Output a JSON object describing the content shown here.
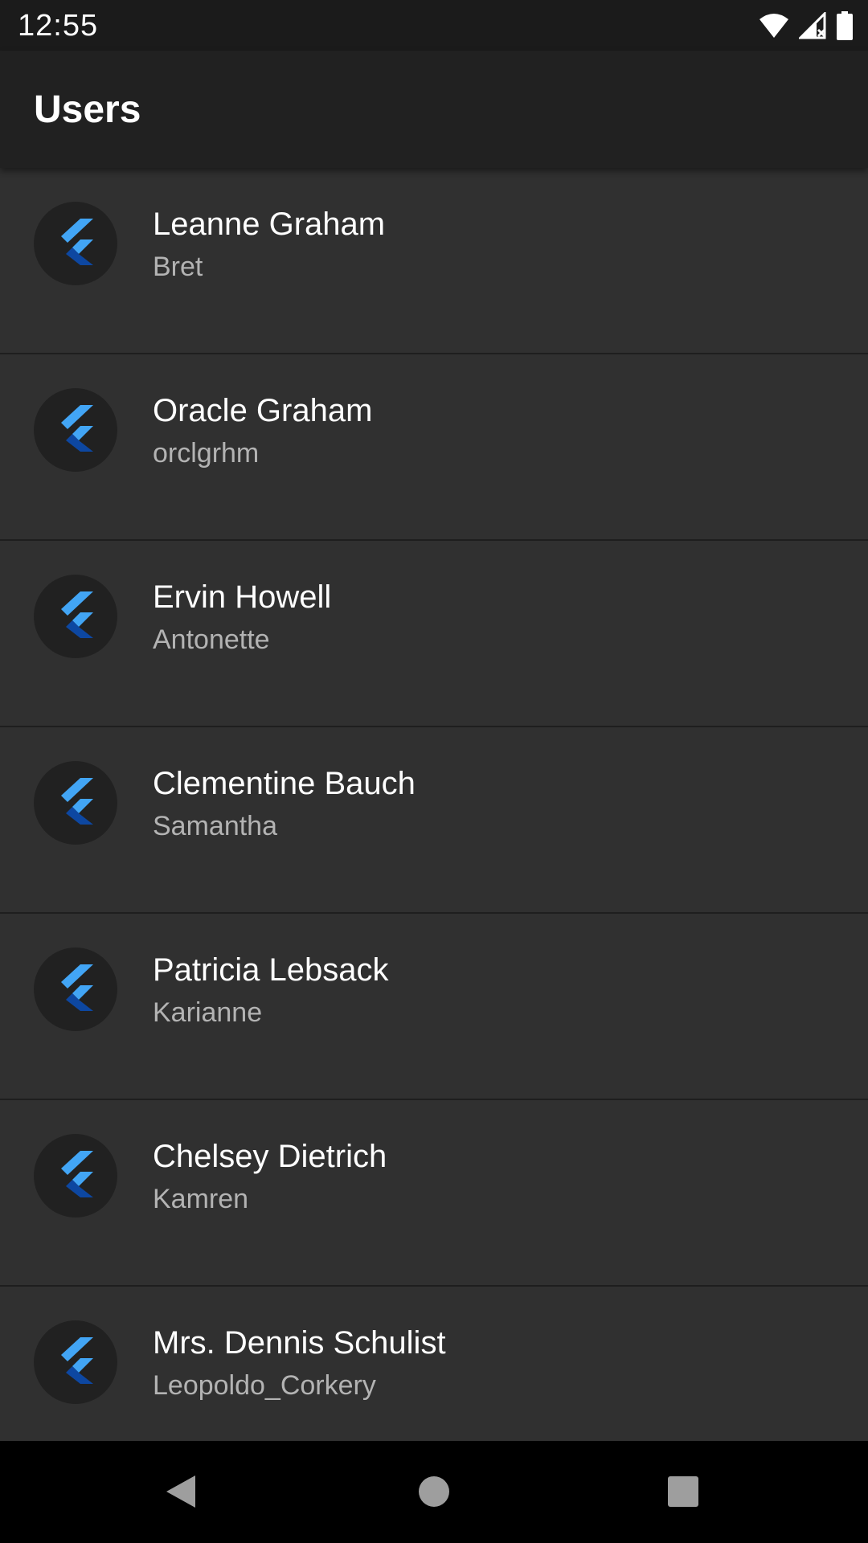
{
  "status_bar": {
    "time": "12:55",
    "icons": [
      "wifi-icon",
      "signal-icon",
      "battery-icon"
    ]
  },
  "app_bar": {
    "title": "Users"
  },
  "users": [
    {
      "name": "Leanne Graham",
      "username": "Bret"
    },
    {
      "name": "Oracle Graham",
      "username": "orclgrhm"
    },
    {
      "name": "Ervin Howell",
      "username": "Antonette"
    },
    {
      "name": "Clementine Bauch",
      "username": "Samantha"
    },
    {
      "name": "Patricia Lebsack",
      "username": "Karianne"
    },
    {
      "name": "Chelsey Dietrich",
      "username": "Kamren"
    },
    {
      "name": "Mrs. Dennis Schulist",
      "username": "Leopoldo_Corkery"
    }
  ],
  "avatar_icon": "flutter-logo-icon",
  "nav_bar": {
    "buttons": [
      "back-icon",
      "home-icon",
      "recents-icon"
    ]
  },
  "colors": {
    "background": "#303030",
    "app_bar": "#212121",
    "status_bar": "#1b1b1b",
    "avatar_bg": "#212121",
    "divider": "#1e1e1e",
    "logo_light": "#42a5f5",
    "logo_dark": "#0d47a1"
  }
}
